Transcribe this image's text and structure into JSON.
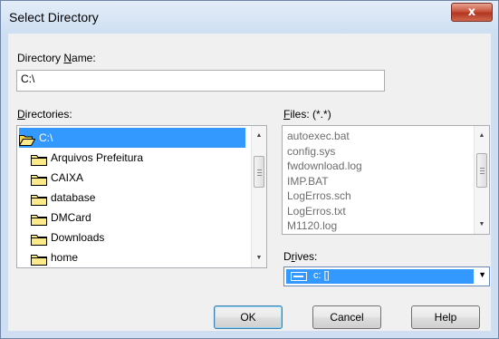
{
  "window": {
    "title": "Select Directory",
    "close_glyph": "x"
  },
  "directory_name": {
    "label_pre": "Directory ",
    "label_key": "N",
    "label_post": "ame:",
    "value": "C:\\"
  },
  "directories": {
    "label_key": "D",
    "label_post": "irectories:",
    "items": [
      {
        "label": "C:\\",
        "icon": "folder-open-icon",
        "selected": true
      },
      {
        "label": "Arquivos Prefeitura",
        "icon": "folder-icon"
      },
      {
        "label": "CAIXA",
        "icon": "folder-icon"
      },
      {
        "label": "database",
        "icon": "folder-icon"
      },
      {
        "label": "DMCard",
        "icon": "folder-icon"
      },
      {
        "label": "Downloads",
        "icon": "folder-icon"
      },
      {
        "label": "home",
        "icon": "folder-icon"
      }
    ]
  },
  "files": {
    "label_key": "F",
    "label_post": "iles: (*.*)",
    "items": [
      "autoexec.bat",
      "config.sys",
      "fwdownload.log",
      "IMP.BAT",
      "LogErros.sch",
      "LogErros.txt",
      "M1120.log"
    ]
  },
  "drives": {
    "label_pre": "D",
    "label_key": "r",
    "label_post": "ives:",
    "value": "c: []",
    "icon": "drive-icon"
  },
  "buttons": {
    "ok": "OK",
    "cancel": "Cancel",
    "help": "Help"
  },
  "colors": {
    "selection": "#3399ff",
    "close_button": "#c8553e",
    "title_bar": "#d5e3f3"
  }
}
